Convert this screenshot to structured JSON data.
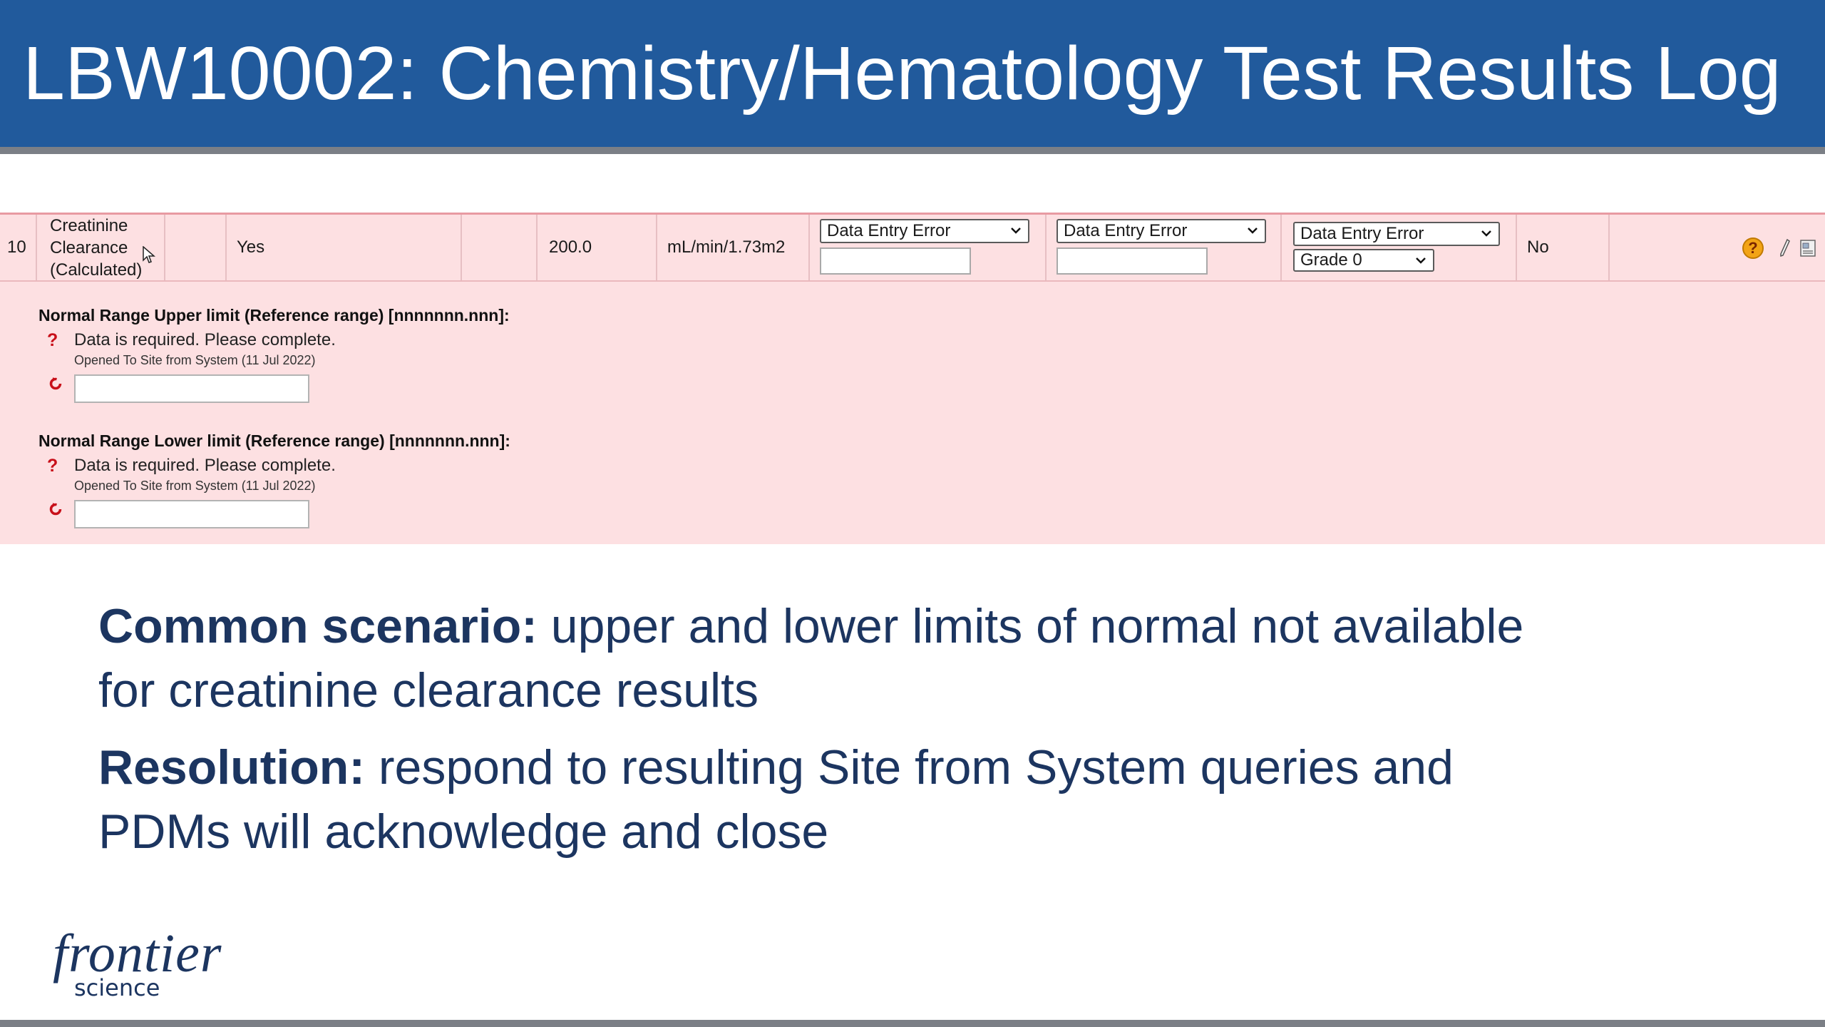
{
  "title": "LBW10002: Chemistry/Hematology Test Results Log",
  "row": {
    "number": "10",
    "test_name_line1": "Creatinine",
    "test_name_line2": "Clearance",
    "test_name_line3": "(Calculated)",
    "done": "Yes",
    "result": "200.0",
    "units": "mL/min/1.73m2",
    "select_1": "Data Entry Error",
    "select_2": "Data Entry Error",
    "select_3": "Data Entry Error",
    "grade_select": "Grade 0",
    "clinically_significant": "No"
  },
  "queries": [
    {
      "label": "Normal Range Upper limit (Reference range) [nnnnnnn.nnn]:",
      "message": "Data is required. Please complete.",
      "status": "Opened To Site from System (11 Jul 2022)"
    },
    {
      "label": "Normal Range Lower limit (Reference range) [nnnnnnn.nnn]:",
      "message": "Data is required. Please complete.",
      "status": "Opened To Site from System (11 Jul 2022)"
    }
  ],
  "body": {
    "scenario_heading": "Common scenario:",
    "scenario_text_1": " upper and lower limits of normal not available",
    "scenario_text_2": "for creatinine clearance results",
    "resolution_heading": "Resolution:",
    "resolution_text_1": " respond to resulting Site from System queries and",
    "resolution_text_2": "PDMs will acknowledge and close"
  },
  "logo": {
    "brand": "frontier",
    "sub": "science"
  },
  "colors": {
    "banner": "#215a9c",
    "row_bg": "#fde0e2",
    "body_text": "#1c3560",
    "query_mark": "#c8101a"
  }
}
